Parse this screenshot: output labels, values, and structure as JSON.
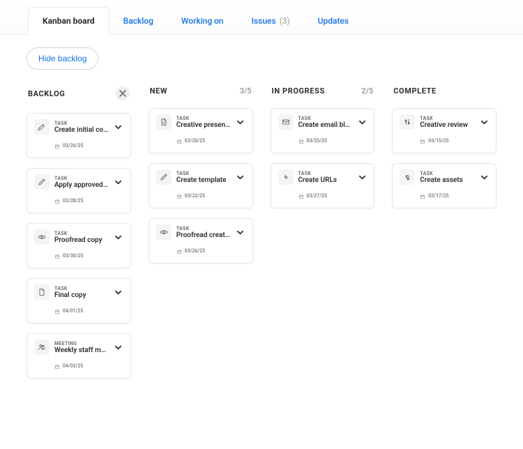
{
  "tabs": {
    "kanban": "Kanban board",
    "backlog": "Backlog",
    "working": "Working on",
    "issues": "Issues",
    "issues_count": "(3)",
    "updates": "Updates"
  },
  "toolbar": {
    "hide_backlog": "Hide backlog"
  },
  "columns": {
    "backlog": {
      "title": "BACKLOG"
    },
    "new": {
      "title": "NEW",
      "count": "3/5"
    },
    "inprog": {
      "title": "IN PROGRESS",
      "count": "2/5"
    },
    "complete": {
      "title": "COMPLETE"
    }
  },
  "labels": {
    "task": "TASK",
    "meeting": "MEETING"
  },
  "cards": {
    "backlog": [
      {
        "type_key": "task",
        "title": "Create initial copy",
        "date": "03/26/25",
        "icon": "pen"
      },
      {
        "type_key": "task",
        "title": "Apply approved edits",
        "date": "03/28/25",
        "icon": "pencil"
      },
      {
        "type_key": "task",
        "title": "Proofread copy",
        "date": "03/30/25",
        "icon": "eye"
      },
      {
        "type_key": "task",
        "title": "Final copy",
        "date": "04/01/25",
        "icon": "file"
      },
      {
        "type_key": "meeting",
        "title": "Weekly staff meeting",
        "date": "04/03/25",
        "icon": "people"
      }
    ],
    "new": [
      {
        "type_key": "task",
        "title": "Creative presentation",
        "date": "03/20/25",
        "icon": "file-lines"
      },
      {
        "type_key": "task",
        "title": "Create template",
        "date": "03/22/25",
        "icon": "pencil"
      },
      {
        "type_key": "task",
        "title": "Proofread creative",
        "date": "03/26/25",
        "icon": "eye"
      }
    ],
    "inprog": [
      {
        "type_key": "task",
        "title": "Create email blast copy",
        "date": "03/25/25",
        "icon": "mail"
      },
      {
        "type_key": "task",
        "title": "Create URLs",
        "date": "03/27/25",
        "icon": "link"
      }
    ],
    "complete": [
      {
        "type_key": "task",
        "title": "Creative review",
        "date": "03/15/25",
        "icon": "sliders"
      },
      {
        "type_key": "task",
        "title": "Create assets",
        "date": "03/17/25",
        "icon": "wrench"
      }
    ]
  }
}
